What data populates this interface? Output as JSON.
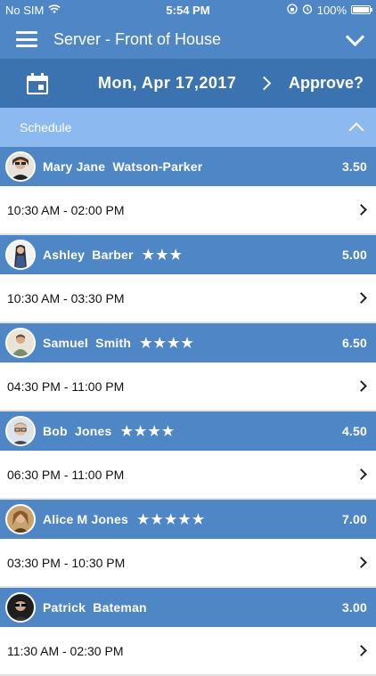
{
  "status_bar": {
    "carrier": "No SIM",
    "time": "5:54 PM",
    "battery": "100%"
  },
  "nav": {
    "title": "Server - Front of House"
  },
  "date_bar": {
    "date": "Mon, Apr 17,2017",
    "approve_label": "Approve?"
  },
  "schedule_header": {
    "label": "Schedule"
  },
  "employees": [
    {
      "name": "Mary Jane  Watson-Parker",
      "stars": "",
      "hours": "3.50",
      "shift": "10:30 AM - 02:00 PM"
    },
    {
      "name": "Ashley  Barber",
      "stars": "★★★",
      "hours": "5.00",
      "shift": "10:30 AM - 03:30 PM"
    },
    {
      "name": "Samuel  Smith",
      "stars": "★★★★",
      "hours": "6.50",
      "shift": "04:30 PM - 11:00 PM"
    },
    {
      "name": "Bob  Jones",
      "stars": "★★★★",
      "hours": "4.50",
      "shift": "06:30 PM - 11:00 PM"
    },
    {
      "name": "Alice M Jones",
      "stars": "★★★★★",
      "hours": "7.00",
      "shift": "03:30 PM - 10:30 PM"
    },
    {
      "name": "Patrick  Bateman",
      "stars": "",
      "hours": "3.00",
      "shift": "11:30 AM - 02:30 PM"
    }
  ]
}
